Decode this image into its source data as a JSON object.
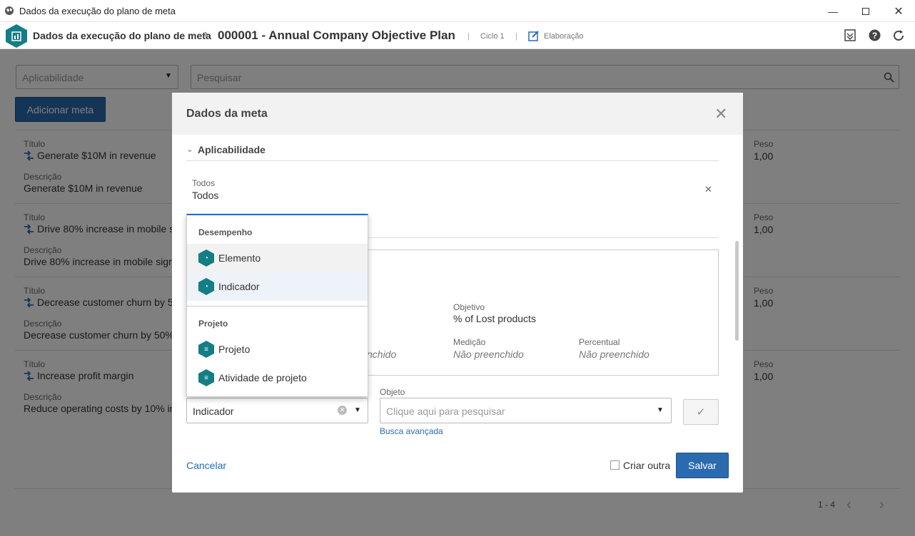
{
  "window": {
    "title": "Dados da execução do plano de meta"
  },
  "header": {
    "section": "Dados da execução do plano de meta",
    "plan_title": "000001 - Annual Company Objective Plan",
    "cycle": "Ciclo 1",
    "status": "Elaboração"
  },
  "filters": {
    "applicability_placeholder": "Aplicabilidade",
    "search_placeholder": "Pesquisar"
  },
  "add_goal_label": "Adicionar meta",
  "goal_rows": [
    {
      "title_label": "Título",
      "title": "Generate $10M in revenue",
      "desc_label": "Descrição",
      "desc": "Generate $10M in revenue",
      "weight_label": "Peso",
      "weight": "1,00"
    },
    {
      "title_label": "Título",
      "title": "Drive 80% increase in mobile s",
      "desc_label": "Descrição",
      "desc": "Drive 80% increase in mobile sign",
      "weight_label": "Peso",
      "weight": "1,00"
    },
    {
      "title_label": "Título",
      "title": "Decrease customer churn by 5",
      "desc_label": "Descrição",
      "desc": "Decrease customer churn by 50%",
      "weight_label": "Peso",
      "weight": "1,00"
    },
    {
      "title_label": "Título",
      "title": "Increase profit margin",
      "desc_label": "Descrição",
      "desc": "Reduce operating costs by 10% in",
      "weight_label": "Peso",
      "weight": "1,00"
    }
  ],
  "pagination": {
    "range": "1 - 4"
  },
  "modal": {
    "title": "Dados da meta",
    "section": "Aplicabilidade",
    "applicability_label": "Todos",
    "applicability_value": "Todos",
    "objective_label": "Objetivo",
    "objective_value": "% of Lost products",
    "partial_value": "nchido",
    "measurement_label": "Medição",
    "measurement_value": "Não preenchido",
    "percent_label": "Percentual",
    "percent_value": "Não preenchido",
    "type_value": "Indicador",
    "object_label": "Objeto",
    "object_placeholder": "Clique aqui para pesquisar",
    "advanced_search": "Busca avançada",
    "cancel": "Cancelar",
    "create_another": "Criar outra",
    "save": "Salvar"
  },
  "dropdown": {
    "groups": [
      {
        "label": "Desempenho",
        "items": [
          "Elemento",
          "Indicador"
        ]
      },
      {
        "label": "Projeto",
        "items": [
          "Projeto",
          "Atividade de projeto"
        ]
      }
    ]
  },
  "colors": {
    "brand_teal": "#147d86",
    "primary_blue": "#2b6aaf"
  }
}
